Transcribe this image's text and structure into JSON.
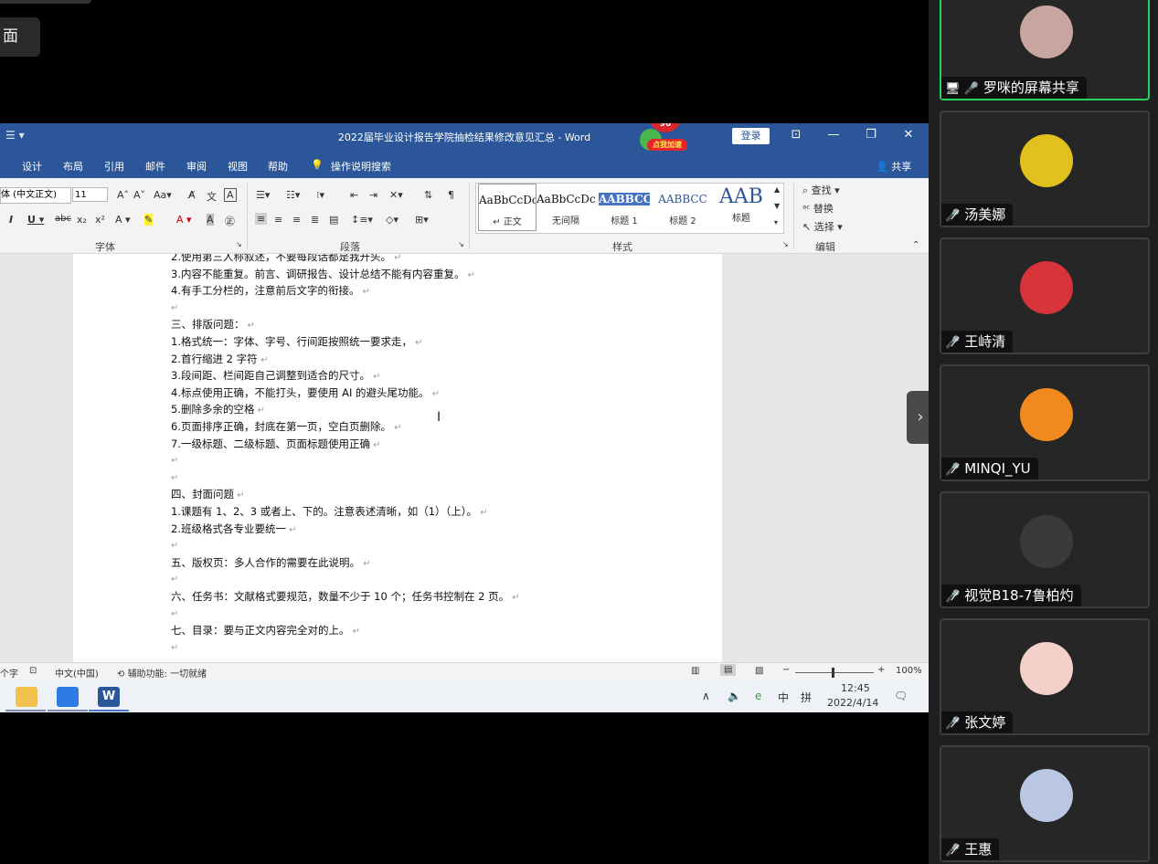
{
  "overlay": {
    "chip_text": "面"
  },
  "word": {
    "window_title": "2022届毕业设计报告学院抽检结果修改意见汇总  -  Word",
    "quick_access": "☰  ▾",
    "login_label": "登录",
    "badge": {
      "count": "96",
      "label": "点我加速"
    },
    "tabs": [
      "设计",
      "布局",
      "引用",
      "邮件",
      "审阅",
      "视图",
      "帮助",
      "操作说明搜索"
    ],
    "share_label": "共享",
    "ribbon": {
      "font_name": "体 (中文正文)",
      "font_size": "11",
      "group_font": "字体",
      "group_paragraph": "段落",
      "group_styles": "样式",
      "group_editing": "编辑",
      "styles": [
        {
          "sample": "AaBbCcDc",
          "name": "↵ 正文"
        },
        {
          "sample": "AaBbCcDc",
          "name": "无间隔"
        },
        {
          "sample": "AABBCC",
          "name": "标题 1"
        },
        {
          "sample": "AABBCC",
          "name": "标题 2"
        },
        {
          "sample": "AAB",
          "name": "标题"
        }
      ],
      "edit_find": "查找",
      "edit_replace": "替换",
      "edit_select": "选择"
    },
    "doc_lines": [
      "2.使用第三人称叙述，不要每段话都是我开头。",
      "3.内容不能重复。前言、调研报告、设计总结不能有内容重复。",
      "4.有手工分栏的，注意前后文字的衔接。",
      "",
      "三、排版问题：",
      "1.格式统一：字体、字号、行间距按照统一要求走，",
      "2.首行缩进 2 字符 ",
      "3.段间距、栏间距自己调整到适合的尺寸。",
      "4.标点使用正确，不能打头，要使用 AI 的避头尾功能。",
      "5.删除多余的空格",
      "6.页面排序正确，封底在第一页，空白页删除。",
      "7.一级标题、二级标题、页面标题使用正确",
      "",
      "",
      "四、封面问题",
      "1.课题有 1、2、3 或者上、下的。注意表述清晰，如（1）（上）。",
      "2.班级格式各专业要统一",
      "",
      "五、版权页：多人合作的需要在此说明。",
      "",
      "六、任务书：文献格式要规范，数量不少于 10 个；任务书控制在 2 页。",
      "",
      "七、目录：要与正文内容完全对的上。",
      ""
    ],
    "status": {
      "words": "个字",
      "lang": "中文(中国)",
      "access": "辅助功能: 一切就绪",
      "zoom": "100%"
    },
    "taskbar": {
      "time": "12:45",
      "date": "2022/4/14",
      "ime": "中",
      "ime2": "拼"
    }
  },
  "participants": [
    {
      "name": "罗咪的屏幕共享",
      "speaking": true,
      "color": "#c9a5a0"
    },
    {
      "name": "汤美娜",
      "speaking": false,
      "color": "#e2c11e"
    },
    {
      "name": "王峙清",
      "speaking": false,
      "color": "#d8323b"
    },
    {
      "name": "MINQI_YU",
      "speaking": false,
      "color": "#f08a1e"
    },
    {
      "name": "视觉B18-7鲁柏灼",
      "speaking": false,
      "color": "#3a3a3a"
    },
    {
      "name": "张文婷",
      "speaking": false,
      "color": "#f3d1c8"
    },
    {
      "name": "王惠",
      "speaking": false,
      "color": "#b9c7e3"
    }
  ]
}
